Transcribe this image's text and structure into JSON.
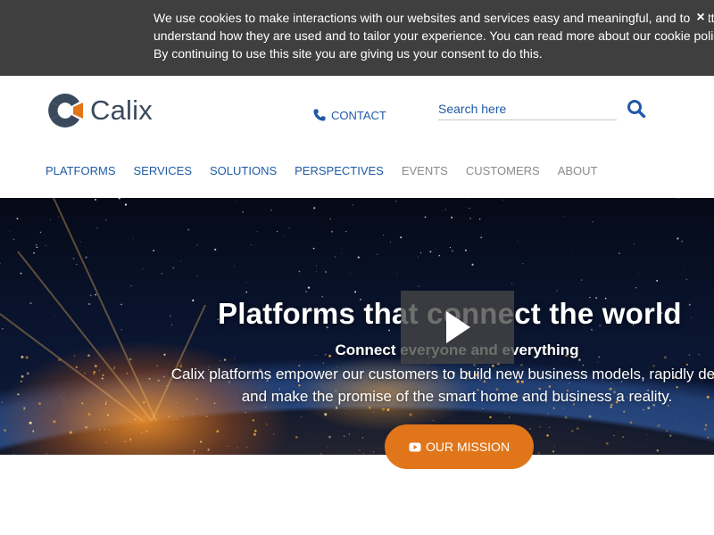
{
  "cookie_banner": {
    "lines": [
      "We use cookies to make interactions with our websites and services easy and meaningful, and to better",
      "understand how they are used and to tailor your experience. You can read more about our cookie policy",
      "By continuing to use this site you are giving us your consent to do this."
    ],
    "close_label": "×"
  },
  "header": {
    "logo_text": "Calix",
    "contact_label": "CONTACT",
    "search": {
      "placeholder": "Search here",
      "value": ""
    },
    "nav": [
      {
        "label": "PLATFORMS",
        "color": "#1f5aa6"
      },
      {
        "label": "SERVICES",
        "color": "#1f5aa6"
      },
      {
        "label": "SOLUTIONS",
        "color": "#1f5aa6"
      },
      {
        "label": "PERSPECTIVES",
        "color": "#1f5aa6"
      },
      {
        "label": "EVENTS",
        "color": "#8a8a8a"
      },
      {
        "label": "CUSTOMERS",
        "color": "#8a8a8a"
      },
      {
        "label": "ABOUT",
        "color": "#8a8a8a"
      }
    ]
  },
  "hero": {
    "title": "Platforms that connect the world",
    "subtitle": "Connect everyone and everything",
    "description_lines": [
      "Calix platforms empower our customers to build new business models, rapidly deploy",
      "and make the promise of the smart home and business a reality."
    ],
    "mission_button_label": "OUR MISSION"
  },
  "icons": {
    "logo": "calix-logo-icon",
    "phone": "phone-icon",
    "search": "search-icon",
    "play": "play-icon",
    "video": "youtube-play-icon",
    "close": "close-icon"
  },
  "colors": {
    "brand_blue": "#1f5aa6",
    "brand_orange": "#e1751a",
    "banner_bg": "#3f3f3f",
    "logo_navy": "#3a4a5c"
  }
}
